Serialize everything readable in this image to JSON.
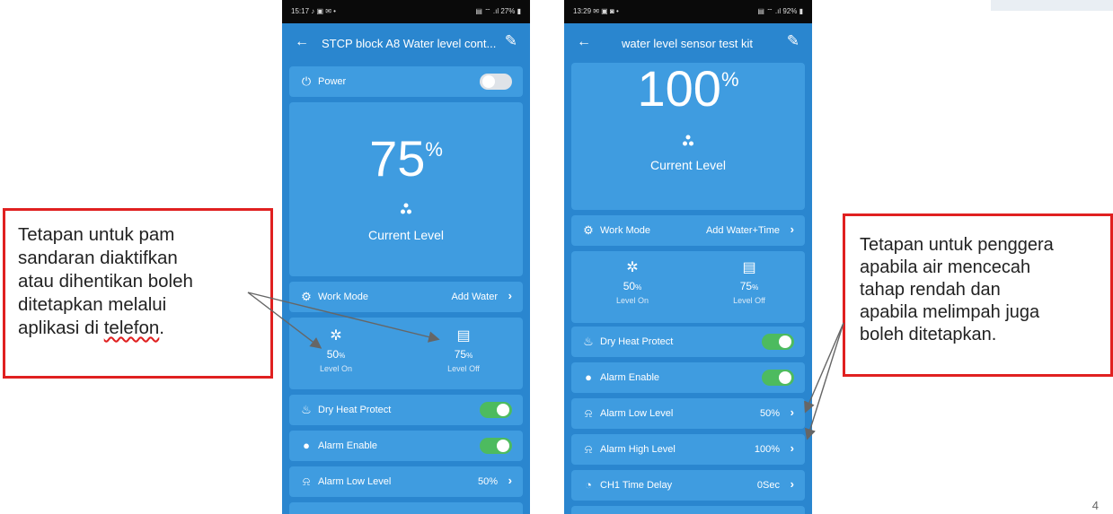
{
  "slide_number": "4",
  "callouts": {
    "left": {
      "lines": [
        "Tetapan untuk pam",
        "sandaran diaktifkan",
        "atau dihentikan boleh",
        "ditetapkan melalui"
      ],
      "last_line_pre": "aplikasi di ",
      "last_line_err": "telefon",
      "last_line_post": "."
    },
    "right": {
      "lines": [
        "Tetapan untuk penggera",
        "apabila air mencecah",
        "tahap rendah dan",
        "apabila melimpah juga",
        "boleh ditetapkan."
      ]
    }
  },
  "phone_left": {
    "status_time": "15:17 ♪ ▣ ✉ •",
    "status_sys": "▤ ⌔ .ıl 27% ▮",
    "title": "STCP block A8 Water level cont...",
    "power_label": "Power",
    "level_value": "75",
    "level_unit": "%",
    "current_label": "Current Level",
    "work_mode_label": "Work Mode",
    "work_mode_value": "Add Water",
    "level_on_value": "50",
    "level_on_unit": "%",
    "level_on_label": "Level On",
    "level_off_value": "75",
    "level_off_unit": "%",
    "level_off_label": "Level Off",
    "dry_heat_label": "Dry Heat Protect",
    "alarm_enable_label": "Alarm Enable",
    "alarm_low_label": "Alarm Low Level",
    "alarm_low_value": "50%"
  },
  "phone_right": {
    "status_time": "13:29 ✉ ▣ ◙ •",
    "status_sys": "▤ ⌔ .ıl 92% ▮",
    "title": "water level sensor test kit",
    "level_value": "100",
    "level_unit": "%",
    "current_label": "Current Level",
    "work_mode_label": "Work Mode",
    "work_mode_value": "Add Water+Time",
    "level_on_value": "50",
    "level_on_unit": "%",
    "level_on_label": "Level On",
    "level_off_value": "75",
    "level_off_unit": "%",
    "level_off_label": "Level Off",
    "dry_heat_label": "Dry Heat Protect",
    "alarm_enable_label": "Alarm Enable",
    "alarm_low_label": "Alarm Low Level",
    "alarm_low_value": "50%",
    "alarm_high_label": "Alarm High Level",
    "alarm_high_value": "100%",
    "ch1_label": "CH1 Time Delay",
    "ch1_value": "0Sec"
  },
  "toggles": {
    "left_power": false,
    "left_dry_heat": true,
    "left_alarm_enable": true,
    "right_dry_heat": true,
    "right_alarm_enable": true
  },
  "colors": {
    "phone_bg": "#2a86cf",
    "card_bg": "#3f9ce0",
    "callout_border": "#e02020",
    "toggle_on": "#4dbb5f"
  },
  "icons": {
    "power": "power-icon",
    "drop": "water-drop-icon",
    "gear": "gear-icon",
    "fan": "fan-icon",
    "tank": "tank-icon",
    "flame": "flame-icon",
    "alarm": "alarm-icon",
    "clock": "clock-icon"
  }
}
